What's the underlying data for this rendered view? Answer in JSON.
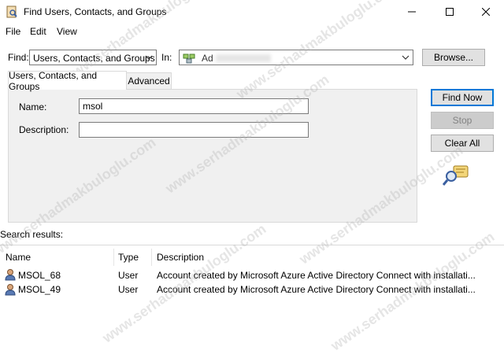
{
  "window": {
    "title": "Find Users, Contacts, and Groups"
  },
  "menu": {
    "items": [
      "File",
      "Edit",
      "View"
    ]
  },
  "find_row": {
    "find_label": "Find:",
    "find_value": "Users, Contacts, and Groups",
    "in_label": "In:",
    "in_value": "Ad",
    "browse_label": "Browse..."
  },
  "tabs": [
    {
      "label": "Users, Contacts, and Groups",
      "active": true
    },
    {
      "label": "Advanced",
      "active": false
    }
  ],
  "form": {
    "name_label": "Name:",
    "name_value": "msol",
    "description_label": "Description:",
    "description_value": ""
  },
  "actions": {
    "find_now": "Find Now",
    "stop": "Stop",
    "clear_all": "Clear All"
  },
  "results": {
    "label": "Search results:",
    "columns": [
      "Name",
      "Type",
      "Description"
    ],
    "rows": [
      {
        "name": "MSOL_68",
        "type": "User",
        "description": "Account created by Microsoft Azure Active Directory Connect with installati..."
      },
      {
        "name": "MSOL_49",
        "type": "User",
        "description": "Account created by Microsoft Azure Active Directory Connect with installati..."
      }
    ]
  },
  "watermark": "www.serhadmakbuloglu.com"
}
